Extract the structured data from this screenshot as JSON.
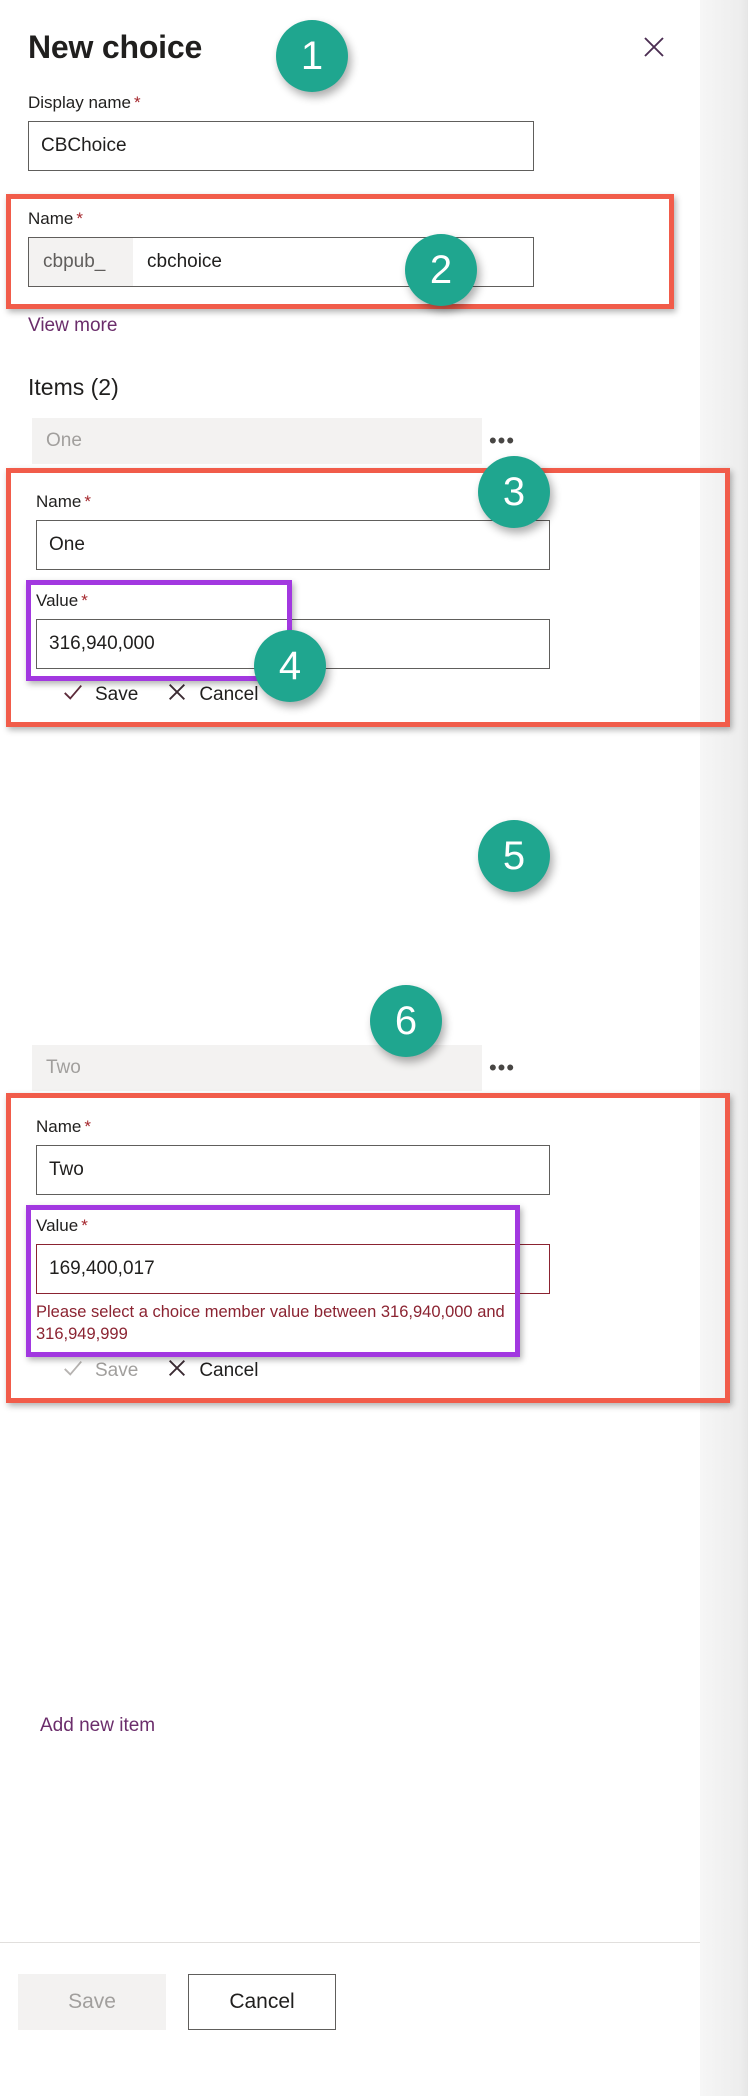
{
  "header": {
    "title": "New choice",
    "close_icon": "close-icon"
  },
  "display_name": {
    "label": "Display name",
    "required_mark": "*",
    "value": "CBChoice"
  },
  "name": {
    "label": "Name",
    "required_mark": "*",
    "prefix": "cbpub_",
    "value": "cbchoice"
  },
  "view_more": {
    "label": "View more"
  },
  "items": {
    "heading": "Items (2)",
    "list": [
      {
        "pill_label": "One",
        "overflow_icon": "more-options-icon",
        "name_label": "Name",
        "name_value": "One",
        "value_label": "Value",
        "value_value": "316,940,000",
        "error": "",
        "save_label": "Save",
        "cancel_label": "Cancel",
        "save_disabled": false
      },
      {
        "pill_label": "Two",
        "overflow_icon": "more-options-icon",
        "name_label": "Name",
        "name_value": "Two",
        "value_label": "Value",
        "value_value": "169,400,017",
        "error": "Please select a choice member value between 316,940,000 and 316,949,999",
        "save_label": "Save",
        "cancel_label": "Cancel",
        "save_disabled": true
      }
    ],
    "add_new_label": "Add new item"
  },
  "footer": {
    "save_label": "Save",
    "cancel_label": "Cancel"
  },
  "annotations": {
    "badges": [
      "1",
      "2",
      "3",
      "4",
      "5",
      "6"
    ]
  },
  "colors": {
    "badge": "#1fa68f",
    "annotation_red": "#f15c4a",
    "annotation_purple": "#a238e0",
    "error": "#8b2331",
    "link": "#6b2d6b",
    "required": "#a4262c"
  }
}
